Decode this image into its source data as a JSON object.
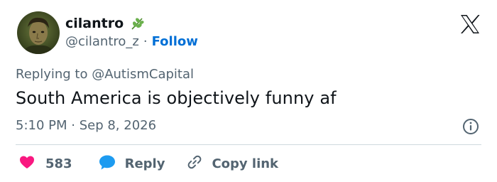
{
  "author": {
    "display_name": "cilantro",
    "handle": "@cilantro_z",
    "separator": "·",
    "follow_label": "Follow",
    "name_emoji": "herb-icon"
  },
  "tweet": {
    "reply_to": "Replying to @AutismCapital",
    "text": "South America is objectively funny af",
    "timestamp": "5:10 PM · Sep 8, 2026"
  },
  "actions": {
    "like_count": "583",
    "reply_label": "Reply",
    "copy_label": "Copy link"
  },
  "colors": {
    "like": "#f91880",
    "reply": "#1d9bf0",
    "link": "#006fd6",
    "muted": "#536471"
  }
}
